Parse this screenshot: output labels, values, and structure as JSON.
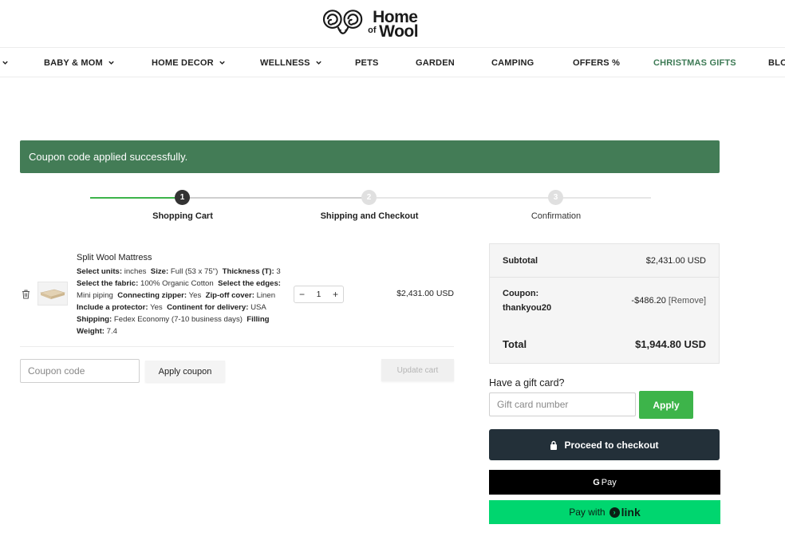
{
  "brand": {
    "line1": "Home",
    "line2": "of",
    "line3": "Wool"
  },
  "nav": {
    "items": [
      {
        "label": "BABY & MOM",
        "dropdown": true
      },
      {
        "label": "HOME DECOR",
        "dropdown": true
      },
      {
        "label": "WELLNESS",
        "dropdown": true
      },
      {
        "label": "PETS",
        "dropdown": false
      },
      {
        "label": "GARDEN",
        "dropdown": false
      },
      {
        "label": "CAMPING",
        "dropdown": false
      },
      {
        "label": "OFFERS %",
        "dropdown": false
      },
      {
        "label": "CHRISTMAS GIFTS",
        "dropdown": false
      },
      {
        "label": "BLO",
        "dropdown": false
      }
    ]
  },
  "alert": {
    "message": "Coupon code applied successfully.",
    "color": "#437c56"
  },
  "steps": [
    {
      "number": "1",
      "label": "Shopping Cart",
      "active": true
    },
    {
      "number": "2",
      "label": "Shipping and Checkout",
      "active": false
    },
    {
      "number": "3",
      "label": "Confirmation",
      "active": false
    }
  ],
  "cart": {
    "item": {
      "name": "Split Wool Mattress",
      "options": [
        {
          "key": "Select units:",
          "value": "inches"
        },
        {
          "key": "Size:",
          "value": "Full (53 x 75\")"
        },
        {
          "key": "Thickness (T):",
          "value": "3"
        },
        {
          "key": "Select the fabric:",
          "value": "100% Organic Cotton"
        },
        {
          "key": "Select the edges:",
          "value": "Mini piping"
        },
        {
          "key": "Connecting zipper:",
          "value": "Yes"
        },
        {
          "key": "Zip-off cover:",
          "value": "Linen"
        },
        {
          "key": "Include a protector:",
          "value": "Yes"
        },
        {
          "key": "Continent for delivery:",
          "value": "USA"
        },
        {
          "key": "Shipping:",
          "value": "Fedex Economy (7-10 business days)"
        },
        {
          "key": "Filling Weight:",
          "value": "7.4"
        }
      ],
      "quantity": "1",
      "minus": "−",
      "plus": "+",
      "price": "$2,431.00 USD"
    },
    "coupon_placeholder": "Coupon code",
    "apply_coupon_label": "Apply coupon",
    "update_cart_label": "Update cart"
  },
  "summary": {
    "subtotal_label": "Subtotal",
    "subtotal_value": "$2,431.00 USD",
    "coupon_label_1": "Coupon:",
    "coupon_label_2": "thankyou20",
    "coupon_value": "-$486.20",
    "remove_label": "[Remove]",
    "total_label": "Total",
    "total_value": "$1,944.80 USD"
  },
  "gift": {
    "label": "Have a gift card?",
    "placeholder": "Gift card number",
    "apply_label": "Apply"
  },
  "checkout": {
    "label": "Proceed to checkout"
  },
  "gpay": {
    "g": "G",
    "label": "Pay"
  },
  "link": {
    "prefix": "Pay with",
    "brand": "link",
    "mark": "›"
  },
  "colors": {
    "green_button": "#3db44a",
    "checkout_bg": "#233039",
    "link_bg": "#00d66f",
    "christmas": "#3d7a55"
  }
}
